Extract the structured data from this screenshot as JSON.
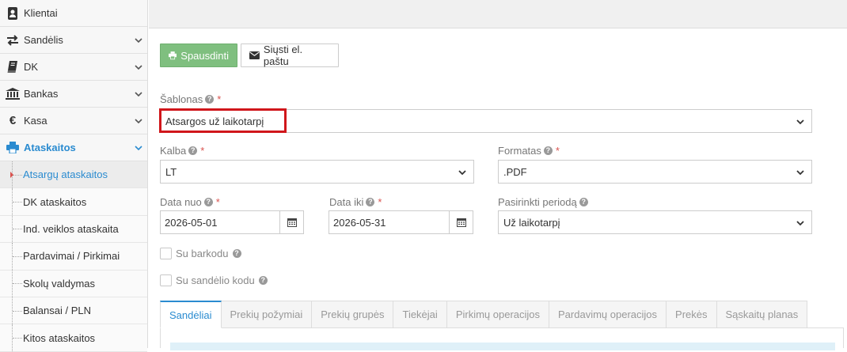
{
  "sidebar": {
    "items": [
      {
        "label": "Klientai",
        "icon": "contacts-book-icon"
      },
      {
        "label": "Sandėlis",
        "icon": "exchange-arrows-icon"
      },
      {
        "label": "DK",
        "icon": "book-icon"
      },
      {
        "label": "Bankas",
        "icon": "bank-icon"
      },
      {
        "label": "Kasa",
        "icon": "euro-icon"
      },
      {
        "label": "Ataskaitos",
        "icon": "print-icon"
      }
    ],
    "subitems": [
      {
        "label": "Atsargų ataskaitos"
      },
      {
        "label": "DK ataskaitos"
      },
      {
        "label": "Ind. veiklos ataskaita"
      },
      {
        "label": "Pardavimai / Pirkimai"
      },
      {
        "label": "Skolų valdymas"
      },
      {
        "label": "Balansai / PLN"
      },
      {
        "label": "Kitos ataskaitos"
      }
    ]
  },
  "toolbar": {
    "print_label": "Spausdinti",
    "email_label": "Siųsti el. paštu"
  },
  "form": {
    "template": {
      "label": "Šablonas",
      "value": "Atsargos už laikotarpį"
    },
    "language": {
      "label": "Kalba",
      "value": "LT"
    },
    "format": {
      "label": "Formatas",
      "value": ".PDF"
    },
    "date_from": {
      "label": "Data nuo",
      "value": "2026-05-01"
    },
    "date_to": {
      "label": "Data iki",
      "value": "2026-05-31"
    },
    "period": {
      "label": "Pasirinkti periodą",
      "value": "Už laikotarpį"
    },
    "with_barcode": {
      "label": "Su barkodu"
    },
    "with_warehouse_code": {
      "label": "Su sandėlio kodu"
    }
  },
  "tabs": [
    {
      "label": "Sandėliai"
    },
    {
      "label": "Prekių požymiai"
    },
    {
      "label": "Prekių grupės"
    },
    {
      "label": "Tiekėjai"
    },
    {
      "label": "Pirkimų operacijos"
    },
    {
      "label": "Pardavimų operacijos"
    },
    {
      "label": "Prekės"
    },
    {
      "label": "Sąskaitų planas"
    }
  ],
  "colors": {
    "accent": "#2a8bd0",
    "print_button": "#7fbf7f",
    "required": "#d9534f",
    "highlight": "#d0161b"
  }
}
